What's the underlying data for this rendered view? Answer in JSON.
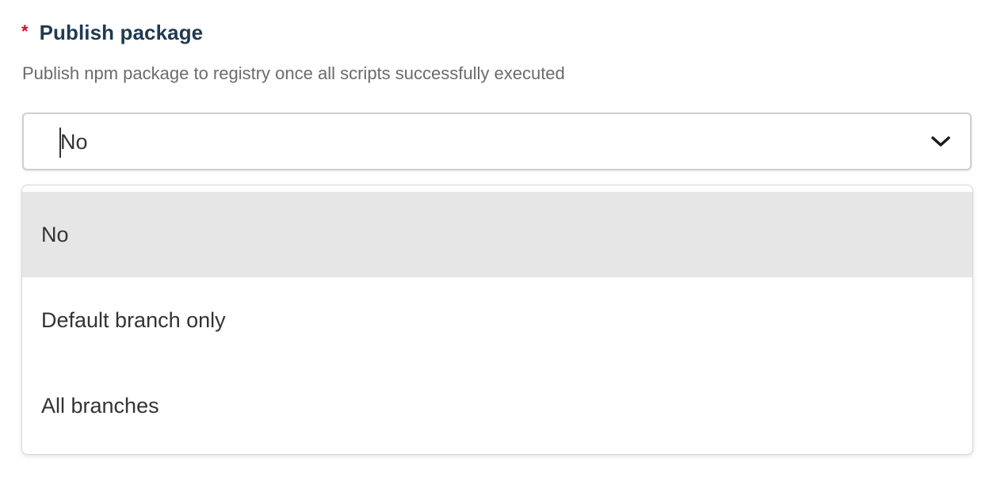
{
  "field": {
    "required_mark": "*",
    "title": "Publish package",
    "description": "Publish npm package to registry once all scripts successfully executed"
  },
  "select": {
    "value": "No",
    "icon": "chevron-down-icon",
    "open": true
  },
  "options": [
    {
      "label": "No",
      "selected": true
    },
    {
      "label": "Default branch only",
      "selected": false
    },
    {
      "label": "All branches",
      "selected": false
    }
  ],
  "colors": {
    "required": "#c8102e",
    "title": "#1f3a52",
    "description": "#6b6b6b",
    "selected_option_bg": "#e6e6e6"
  }
}
